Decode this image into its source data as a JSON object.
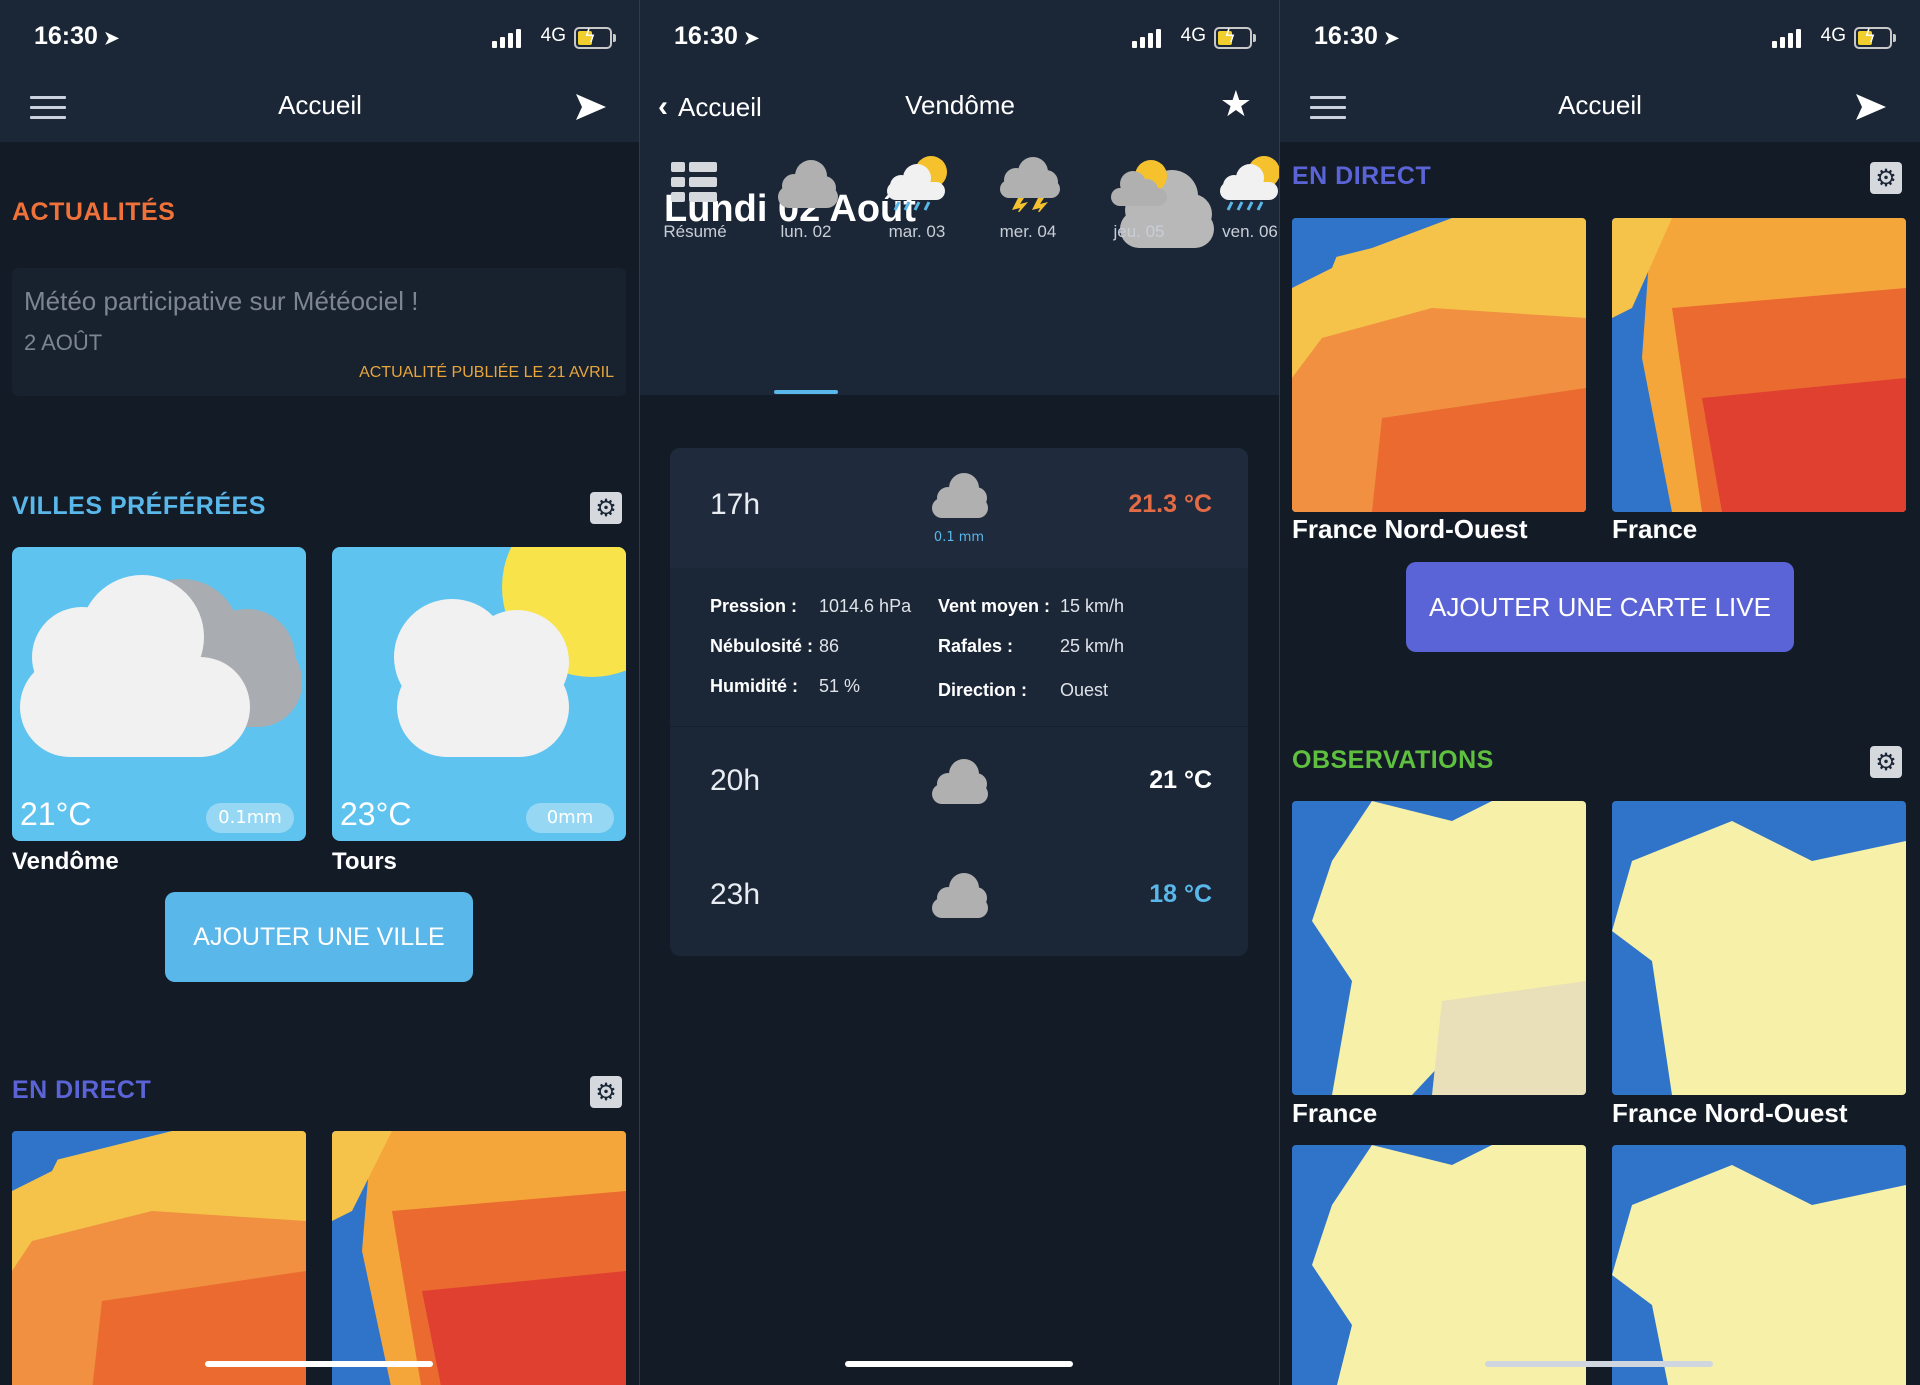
{
  "status_bar": {
    "time": "16:30",
    "network": "4G"
  },
  "colors": {
    "bg": "#131b26",
    "bar": "#1b2637",
    "actualites": "#f0723a",
    "villes": "#5ab7ea",
    "direct": "#5b64d6",
    "observations": "#5fbf3e"
  },
  "panel1": {
    "nav_title": "Accueil",
    "actualites_title": "ACTUALITÉS",
    "news": {
      "title": "Météo participative sur Météociel !",
      "date": "2 AOÛT",
      "published": "ACTUALITÉ PUBLIÉE LE 21 AVRIL"
    },
    "villes_title": "VILLES PRÉFÉRÉES",
    "cities": [
      {
        "name": "Vendôme",
        "temp": "21°C",
        "precip": "0.1mm",
        "icon": "cloud-icon"
      },
      {
        "name": "Tours",
        "temp": "23°C",
        "precip": "0mm",
        "icon": "partly-sunny-icon"
      }
    ],
    "add_city": "AJOUTER UNE VILLE",
    "direct_title": "EN DIRECT"
  },
  "panel2": {
    "back_label": "Accueil",
    "nav_title": "Vendôme",
    "day_title": "Lundi 02 Août",
    "days": [
      {
        "label": "Résumé",
        "icon": "grid-icon"
      },
      {
        "label": "lun. 02",
        "icon": "cloud-icon"
      },
      {
        "label": "mar. 03",
        "icon": "rain-sun-icon"
      },
      {
        "label": "mer. 04",
        "icon": "storm-icon"
      },
      {
        "label": "jeu. 05",
        "icon": "partly-sunny-icon"
      },
      {
        "label": "ven. 06",
        "icon": "rain-sun-icon"
      }
    ],
    "hours": [
      {
        "time": "17h",
        "temp": "21.3 °C",
        "precip": "0.1 mm",
        "temp_color": "#e36b45"
      },
      {
        "time": "20h",
        "temp": "21 °C",
        "temp_color": "#ffffff"
      },
      {
        "time": "23h",
        "temp": "18 °C",
        "temp_color": "#5ab7ea"
      }
    ],
    "details": {
      "pression_k": "Pression :",
      "pression_v": "1014.6 hPa",
      "nebul_k": "Nébulosité :",
      "nebul_v": "86",
      "humid_k": "Humidité :",
      "humid_v": "51 %",
      "vent_k": "Vent moyen :",
      "vent_v": "15 km/h",
      "rafales_k": "Rafales :",
      "rafales_v": "25 km/h",
      "dir_k": "Direction :",
      "dir_v": "Ouest"
    }
  },
  "panel3": {
    "nav_title": "Accueil",
    "direct_title": "EN DIRECT",
    "live_maps": [
      "France Nord-Ouest",
      "France"
    ],
    "add_live": "AJOUTER UNE CARTE LIVE",
    "obs_title": "OBSERVATIONS",
    "obs_maps": [
      "France",
      "France Nord-Ouest"
    ]
  }
}
